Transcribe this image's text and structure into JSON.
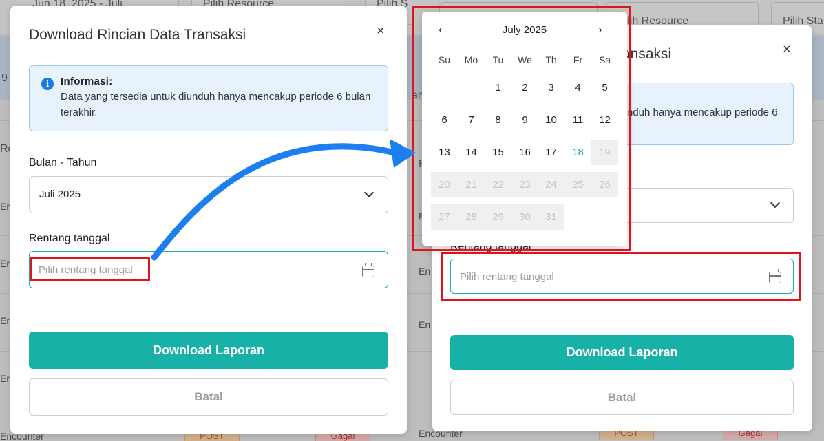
{
  "background": {
    "left_chips": [
      "Jun 18, 2025 - Juli",
      "Pilih Resource",
      "Pilih S"
    ],
    "right_chips": [
      "",
      "Pilih Resource",
      "Pilih Sta"
    ],
    "left_row_labels": [
      "Re",
      "En",
      "En",
      "En",
      "En",
      "Encounter"
    ],
    "right_row_labels": [
      "Re",
      "En",
      "En",
      "En",
      "Encounter"
    ],
    "left_side_9": "9",
    "right_side_an": "an",
    "post_label": "POST",
    "gagal_label": "Gagal"
  },
  "modal": {
    "title": "Download Rincian Data Transaksi",
    "right_title_fragment": "ansaksi",
    "close": "×",
    "info_title": "Informasi:",
    "info_text": "Data yang tersedia untuk diunduh hanya mencakup periode 6 bulan terakhir.",
    "info_text_right": "nduh hanya mencakup periode 6",
    "month_label": "Bulan - Tahun",
    "month_value": "Juli 2025",
    "range_label": "Rentang tanggal",
    "range_placeholder": "Pilih rentang tanggal",
    "download_button": "Download Laporan",
    "cancel_button": "Batal"
  },
  "calendar": {
    "month": "July 2025",
    "prev": "‹",
    "next": "›",
    "weekdays": [
      "Su",
      "Mo",
      "Tu",
      "We",
      "Th",
      "Fr",
      "Sa"
    ],
    "today": 18,
    "first_disabled": 19,
    "days_in_month": 31,
    "first_weekday_index": 2
  },
  "colors": {
    "accent": "#18b1a8",
    "highlight": "#e0141e",
    "arrow": "#1d7ef0",
    "info_bg": "#e8f2fc"
  }
}
